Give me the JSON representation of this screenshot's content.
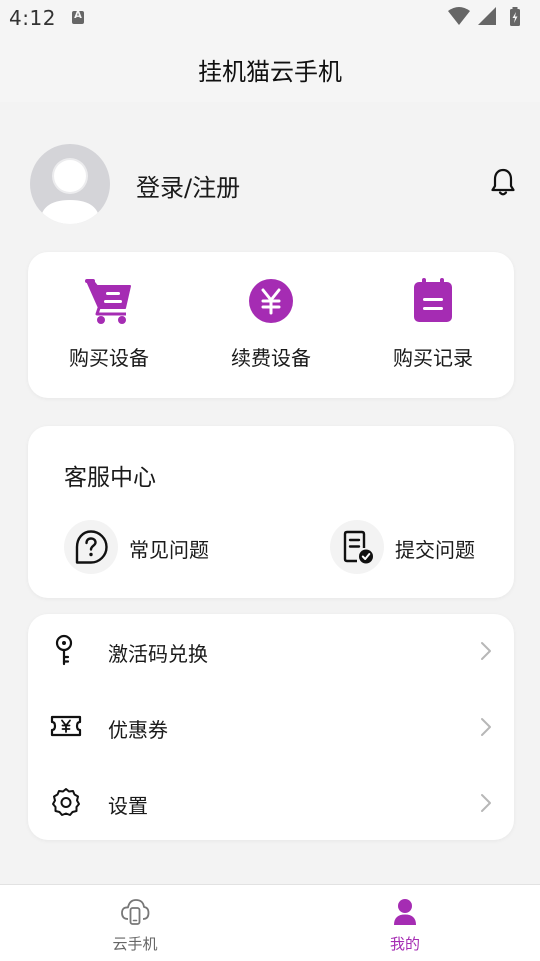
{
  "status_bar": {
    "time": "4:12",
    "notification_badge": "A",
    "icons": [
      "wifi-icon",
      "signal-icon",
      "battery-icon"
    ]
  },
  "header": {
    "title": "挂机猫云手机"
  },
  "profile": {
    "login_label": "登录/注册",
    "icons": [
      "avatar-placeholder",
      "bell-icon"
    ]
  },
  "actions": [
    {
      "label": "购买设备",
      "icon": "cart-icon"
    },
    {
      "label": "续费设备",
      "icon": "yuan-icon"
    },
    {
      "label": "购买记录",
      "icon": "clipboard-icon"
    }
  ],
  "service_center": {
    "title": "客服中心",
    "items": [
      {
        "label": "常见问题",
        "icon": "question-icon"
      },
      {
        "label": "提交问题",
        "icon": "submit-document-icon"
      }
    ]
  },
  "menu": [
    {
      "label": "激活码兑换",
      "icon": "key-icon"
    },
    {
      "label": "优惠券",
      "icon": "coupon-icon"
    },
    {
      "label": "设置",
      "icon": "gear-icon"
    }
  ],
  "bottom_nav": [
    {
      "label": "云手机",
      "icon": "cloud-phone-icon",
      "active": false
    },
    {
      "label": "我的",
      "icon": "person-icon",
      "active": true
    }
  ],
  "colors": {
    "accent": "#a52cb3",
    "background": "#f3f3f3",
    "card": "#ffffff",
    "nav_inactive": "#666666"
  }
}
